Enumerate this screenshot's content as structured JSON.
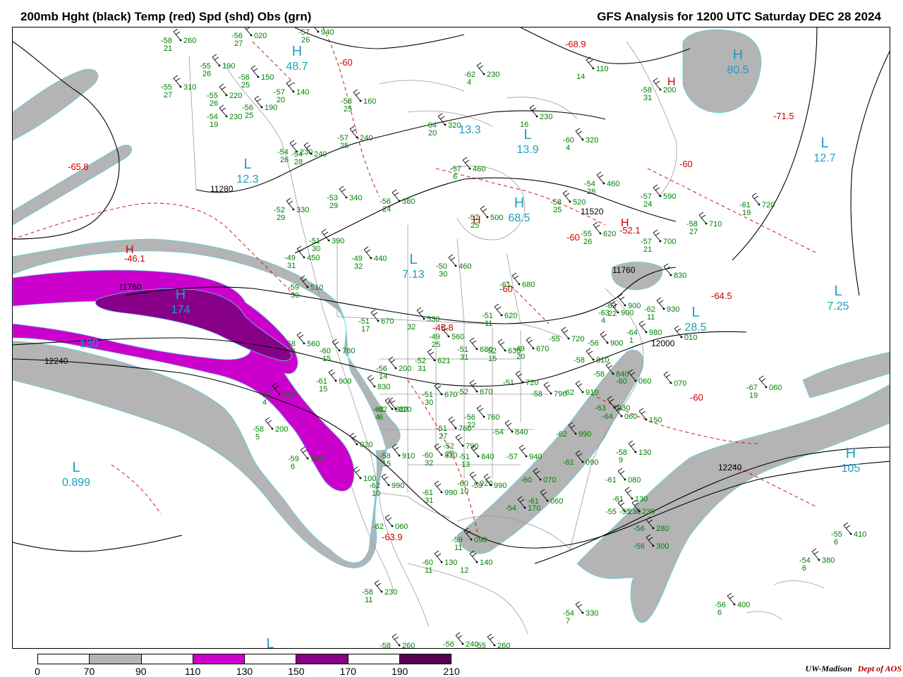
{
  "header": {
    "left_title": "200mb Hght (black) Temp (red) Spd (shd) Obs (grn)",
    "right_title": "GFS Analysis for 1200 UTC Saturday  DEC 28 2024"
  },
  "legend": {
    "ticks": [
      "0",
      "70",
      "90",
      "110",
      "130",
      "150",
      "170",
      "190",
      "210"
    ],
    "colors": [
      "#ffffff",
      "#b4b4b4",
      "#ffffff",
      "#cc00cc",
      "#ffffff",
      "#880088",
      "#ffffff",
      "#550055"
    ]
  },
  "credit": {
    "org": "UW-Madison",
    "dept": "Dept of AOS"
  },
  "colors": {
    "height_contour": "#000000",
    "temperature": "#cc0000",
    "observations": "#008000",
    "speed_label": "#1a9fbf",
    "shade_70_90": "#b4b4b4",
    "shade_110_130": "#cc00cc",
    "shade_150_170": "#880088",
    "coastline": "#888888"
  },
  "contour_labels": [
    "11280",
    "11520",
    "11760",
    "11760",
    "12000",
    "12240",
    "12240"
  ],
  "pressure_centers": [
    {
      "type": "L",
      "value": "12.3"
    },
    {
      "type": "L",
      "value": "7.13"
    },
    {
      "type": "L",
      "value": "13.9"
    },
    {
      "type": "L",
      "value": "12.7"
    },
    {
      "type": "L",
      "value": "7.25"
    },
    {
      "type": "L",
      "value": "28.5"
    },
    {
      "type": "L",
      "value": "0.899"
    },
    {
      "type": "L",
      "value": ""
    },
    {
      "type": "H",
      "value": "48.7"
    },
    {
      "type": "H",
      "value": "68.5"
    },
    {
      "type": "H",
      "value": "80.5"
    },
    {
      "type": "H",
      "value": "174"
    },
    {
      "type": "H",
      "value": "105"
    },
    {
      "type": "",
      "value": "13.3"
    },
    {
      "type": "",
      "value": "130"
    }
  ],
  "temperature_labels": [
    {
      "text": "-68.9"
    },
    {
      "text": "-71.5"
    },
    {
      "text": "-65.8"
    },
    {
      "text": "-46.1"
    },
    {
      "text": "-45.8"
    },
    {
      "text": "-52.1"
    },
    {
      "text": "-64.5"
    },
    {
      "text": "-63.9"
    },
    {
      "text": "-60"
    },
    {
      "text": "-60"
    },
    {
      "text": "-60"
    },
    {
      "text": "-60"
    },
    {
      "text": "-60"
    }
  ],
  "temperature_highs": [
    {
      "type": "H"
    },
    {
      "type": "H"
    },
    {
      "type": "H"
    },
    {
      "type": "H"
    }
  ],
  "observations": [
    {
      "t": "-58",
      "h": "260",
      "d": "21"
    },
    {
      "t": "-56",
      "h": "020",
      "d": "27"
    },
    {
      "t": "-57",
      "h": "940",
      "d": "26"
    },
    {
      "t": "-55",
      "h": "190",
      "d": "26"
    },
    {
      "t": "-55",
      "h": "310",
      "d": "27"
    },
    {
      "t": "-56",
      "h": "150",
      "d": "25"
    },
    {
      "t": "-55",
      "h": "220",
      "d": "26"
    },
    {
      "t": "-57",
      "h": "140",
      "d": "20"
    },
    {
      "t": "-56",
      "h": "190",
      "d": "25"
    },
    {
      "t": "-54",
      "h": "230",
      "d": "19"
    },
    {
      "t": "-54",
      "h": "230",
      "d": "26"
    },
    {
      "t": "-54",
      "h": "240",
      "d": "28"
    },
    {
      "t": "-58",
      "h": "160",
      "d": "25"
    },
    {
      "t": "-57",
      "h": "240",
      "d": "25"
    },
    {
      "t": "-64",
      "h": "320",
      "d": "20"
    },
    {
      "t": "-62",
      "h": "230",
      "d": "4"
    },
    {
      "t": "",
      "h": "230",
      "d": "16"
    },
    {
      "t": "-60",
      "h": "320",
      "d": "4"
    },
    {
      "t": "",
      "h": "110",
      "d": "14"
    },
    {
      "t": "-58",
      "h": "200",
      "d": "31"
    },
    {
      "t": "-53",
      "h": "340",
      "d": "29"
    },
    {
      "t": "-56",
      "h": "380",
      "d": "24"
    },
    {
      "t": "-52",
      "h": "330",
      "d": "29"
    },
    {
      "t": "-57",
      "h": "460",
      "d": "6"
    },
    {
      "t": "-54",
      "h": "460",
      "d": "28"
    },
    {
      "t": "-57",
      "h": "590",
      "d": "24"
    },
    {
      "t": "-61",
      "h": "720",
      "d": "19"
    },
    {
      "t": "-58",
      "h": "520",
      "d": "25"
    },
    {
      "t": "-57",
      "h": "500",
      "d": "25"
    },
    {
      "t": "-55",
      "h": "620",
      "d": "26"
    },
    {
      "t": "-58",
      "h": "710",
      "d": "27"
    },
    {
      "t": "-57",
      "h": "700",
      "d": "21"
    },
    {
      "t": "-51",
      "h": "390",
      "d": "30"
    },
    {
      "t": "-49",
      "h": "440",
      "d": "32"
    },
    {
      "t": "-50",
      "h": "460",
      "d": "30"
    },
    {
      "t": "-49",
      "h": "450",
      "d": "31"
    },
    {
      "t": "-59",
      "h": "510",
      "d": "30"
    },
    {
      "t": "-61",
      "h": "680",
      "d": ""
    },
    {
      "t": "",
      "h": "830",
      "d": ""
    },
    {
      "t": "-63",
      "h": "900",
      "d": "22"
    },
    {
      "t": "-63",
      "h": "900",
      "d": "4"
    },
    {
      "t": "-62",
      "h": "930",
      "d": "11"
    },
    {
      "t": "-51",
      "h": "670",
      "d": "17"
    },
    {
      "t": "",
      "h": "530",
      "d": "32"
    },
    {
      "t": "-51",
      "h": "620",
      "d": "11"
    },
    {
      "t": "-49",
      "h": "560",
      "d": "25"
    },
    {
      "t": "-64",
      "h": "980",
      "d": "1"
    },
    {
      "t": "",
      "h": "010",
      "d": ""
    },
    {
      "t": "-58",
      "h": "560",
      "d": "16"
    },
    {
      "t": "-60",
      "h": "780",
      "d": "15"
    },
    {
      "t": "-56",
      "h": "200",
      "d": "14"
    },
    {
      "t": "-52",
      "h": "621",
      "d": "31"
    },
    {
      "t": "-51",
      "h": "680",
      "d": "31"
    },
    {
      "t": "-52",
      "h": "630",
      "d": "15"
    },
    {
      "t": "-49",
      "h": "670",
      "d": "20"
    },
    {
      "t": "-55",
      "h": "720",
      "d": ""
    },
    {
      "t": "-56",
      "h": "900",
      "d": ""
    },
    {
      "t": "-58",
      "h": "810",
      "d": ""
    },
    {
      "t": "-58",
      "h": "840",
      "d": ""
    },
    {
      "t": "-60",
      "h": "060",
      "d": ""
    },
    {
      "t": "",
      "h": "070",
      "d": ""
    },
    {
      "t": "-67",
      "h": "060",
      "d": "19"
    },
    {
      "t": "-62",
      "h": "820",
      "d": "4"
    },
    {
      "t": "-61",
      "h": "900",
      "d": "15"
    },
    {
      "t": "",
      "h": "830",
      "d": ""
    },
    {
      "t": "-51",
      "h": "720",
      "d": ""
    },
    {
      "t": "-58",
      "h": "790",
      "d": ""
    },
    {
      "t": "-62",
      "h": "910",
      "d": ""
    },
    {
      "t": "-63",
      "h": "030",
      "d": ""
    },
    {
      "t": "-64",
      "h": "060",
      "d": ""
    },
    {
      "t": "",
      "h": "150",
      "d": ""
    },
    {
      "t": "-59",
      "h": "180",
      "d": "4"
    },
    {
      "t": "-62",
      "h": "820",
      "d": "6"
    },
    {
      "t": "-51",
      "h": "670",
      "d": "30"
    },
    {
      "t": "-52",
      "h": "670",
      "d": ""
    },
    {
      "t": "-56",
      "h": "760",
      "d": "22"
    },
    {
      "t": "-51",
      "h": "760",
      "d": "27"
    },
    {
      "t": "-54",
      "h": "840",
      "d": ""
    },
    {
      "t": "-62",
      "h": "990",
      "d": ""
    },
    {
      "t": "-58",
      "h": "200",
      "d": "5"
    },
    {
      "t": "-59",
      "h": "190",
      "d": "6"
    },
    {
      "t": "",
      "h": "100",
      "d": ""
    },
    {
      "t": "",
      "h": "020",
      "d": ""
    },
    {
      "t": "-58",
      "h": "910",
      "d": "15"
    },
    {
      "t": "-60",
      "h": "810",
      "d": "32"
    },
    {
      "t": "-52",
      "h": "790",
      "d": "27"
    },
    {
      "t": "-51",
      "h": "840",
      "d": "13"
    },
    {
      "t": "-57",
      "h": "940",
      "d": ""
    },
    {
      "t": "-61",
      "h": "090",
      "d": ""
    },
    {
      "t": "-58",
      "h": "130",
      "d": "9"
    },
    {
      "t": "-60",
      "h": "920",
      "d": "10"
    },
    {
      "t": "-59",
      "h": "990",
      "d": ""
    },
    {
      "t": "-62",
      "h": "990",
      "d": "10"
    },
    {
      "t": "-61",
      "h": "990",
      "d": "31"
    },
    {
      "t": "-60",
      "h": "070",
      "d": ""
    },
    {
      "t": "-61",
      "h": "080",
      "d": ""
    },
    {
      "t": "-54",
      "h": "170",
      "d": ""
    },
    {
      "t": "-61",
      "h": "060",
      "d": ""
    },
    {
      "t": "-61",
      "h": "130",
      "d": ""
    },
    {
      "t": "-55",
      "h": "230",
      "d": ""
    },
    {
      "t": "-55",
      "h": "230",
      "d": ""
    },
    {
      "t": "-56",
      "h": "280",
      "d": ""
    },
    {
      "t": "-62",
      "h": "060",
      "d": ""
    },
    {
      "t": "-59",
      "h": "090",
      "d": "11"
    },
    {
      "t": "-56",
      "h": "300",
      "d": ""
    },
    {
      "t": "-60",
      "h": "130",
      "d": "11"
    },
    {
      "t": "",
      "h": "140",
      "d": "12"
    },
    {
      "t": "-55",
      "h": "410",
      "d": "6"
    },
    {
      "t": "-54",
      "h": "380",
      "d": "6"
    },
    {
      "t": "-58",
      "h": "230",
      "d": "11"
    },
    {
      "t": "-56",
      "h": "400",
      "d": "6"
    },
    {
      "t": "-54",
      "h": "330",
      "d": "7"
    },
    {
      "t": "-58",
      "h": "260",
      "d": ""
    },
    {
      "t": "-56",
      "h": "240",
      "d": ""
    },
    {
      "t": "-55",
      "h": "260",
      "d": ""
    }
  ]
}
